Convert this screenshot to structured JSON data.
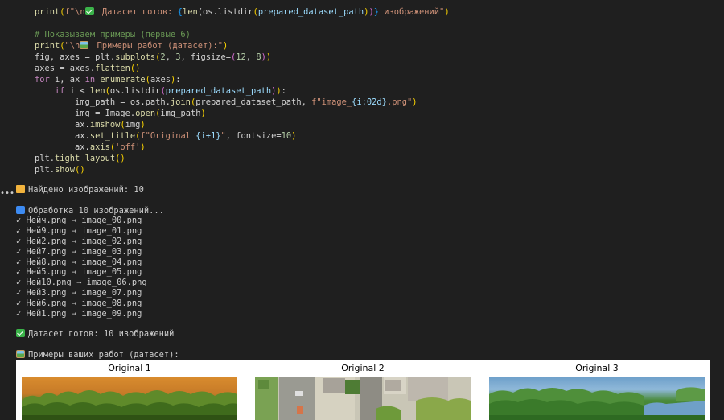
{
  "code": {
    "line1": {
      "a": "print",
      "b": "(",
      "c": "f\"\\n",
      "d": " Датасет готов: ",
      "e": "{",
      "f": "len",
      "g": "(os.listdir",
      "h": "(",
      "i": "prepared_dataset_path",
      "j": ")",
      "k": ")",
      "l": "}",
      "m": " изображений\"",
      "n": ")"
    },
    "comment": "# Показываем примеры (первые 6)",
    "line_print2": {
      "a": "print",
      "b": "(",
      "c": "\"\\n",
      "d": " Примеры работ (датасет):\"",
      "e": ")"
    },
    "line_subplots": {
      "a": "fig, axes = plt.",
      "b": "subplots",
      "c": "(",
      "d": "2",
      "e": ", ",
      "f": "3",
      "g": ", figsize=",
      "h": "(",
      "i": "12",
      "j": ", ",
      "k": "8",
      "l": ")",
      "m": ")"
    },
    "line_flatten": {
      "a": "axes = axes.",
      "b": "flatten",
      "c": "()"
    },
    "line_for": {
      "a": "for",
      "b": " i, ax ",
      "c": "in",
      "d": " ",
      "e": "enumerate",
      "f": "(",
      "g": "axes",
      "h": ")",
      "i": ":"
    },
    "line_if": {
      "a": "if",
      "b": " i < ",
      "c": "len",
      "d": "(",
      "e": "os.listdir",
      "f": "(",
      "g": "prepared_dataset_path",
      "h": ")",
      "i": ")",
      "j": ":"
    },
    "line_imgpath": {
      "a": "img_path = os.path.",
      "b": "join",
      "c": "(",
      "d": "prepared_dataset_path, ",
      "e": "f\"image_",
      "f": "{i:02d}",
      "g": ".png\"",
      "h": ")"
    },
    "line_open": {
      "a": "img = Image.",
      "b": "open",
      "c": "(",
      "d": "img_path",
      "e": ")"
    },
    "line_imshow": {
      "a": "ax.",
      "b": "imshow",
      "c": "(",
      "d": "img",
      "e": ")"
    },
    "line_settitle": {
      "a": "ax.",
      "b": "set_title",
      "c": "(",
      "d": "f\"Original ",
      "e": "{i+1}",
      "f": "\"",
      "g": ", fontsize=",
      "h": "10",
      "i": ")"
    },
    "line_axis": {
      "a": "ax.",
      "b": "axis",
      "c": "(",
      "d": "'off'",
      "e": ")"
    },
    "line_tight": {
      "a": "plt.",
      "b": "tight_layout",
      "c": "()"
    },
    "line_show": {
      "a": "plt.",
      "b": "show",
      "c": "()"
    }
  },
  "output": {
    "ellipsis": "•••",
    "found": "Найдено изображений: 10",
    "processing": "Обработка 10 изображений...",
    "files": [
      "✓ Нейч.png → image_00.png",
      "✓ Ней9.png → image_01.png",
      "✓ Ней2.png → image_02.png",
      "✓ Ней7.png → image_03.png",
      "✓ Ней8.png → image_04.png",
      "✓ Ней5.png → image_05.png",
      "✓ Ней10.png → image_06.png",
      "✓ Ней3.png → image_07.png",
      "✓ Ней6.png → image_08.png",
      "✓ Ней1.png → image_09.png"
    ],
    "ready": "Датасет готов: 10 изображений",
    "examples": "Примеры ваших работ (датасет):"
  },
  "figure": {
    "titles": [
      "Original 1",
      "Original 2",
      "Original 3"
    ]
  },
  "colors": {
    "background": "#1f1f1f",
    "keyword": "#c586c0",
    "function": "#dcdcaa",
    "string": "#ce9178",
    "number": "#b5cea8",
    "comment": "#6a9955"
  }
}
